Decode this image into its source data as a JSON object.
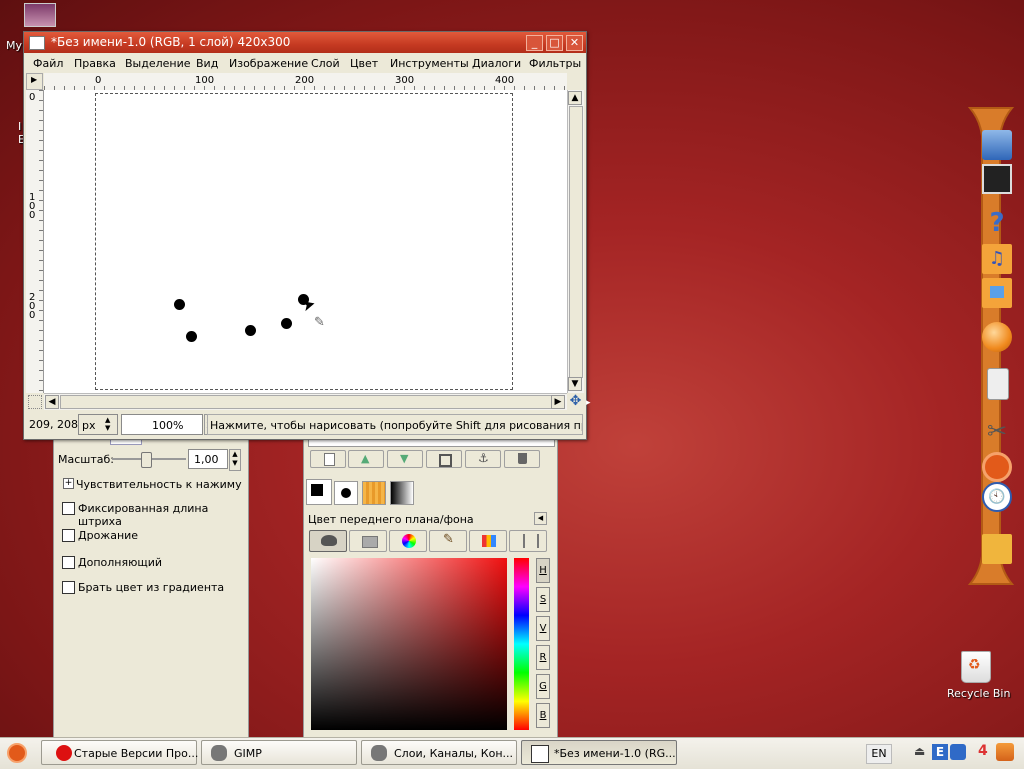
{
  "desktop": {
    "left_label_1": "My",
    "left_label_2": "I",
    "left_label_3": "E",
    "recycle_bin": "Recycle Bin"
  },
  "image_window": {
    "title": "*Без имени-1.0 (RGB, 1 слой) 420x300",
    "menu": [
      "Файл",
      "Правка",
      "Выделение",
      "Вид",
      "Изображение",
      "Слой",
      "Цвет",
      "Инструменты",
      "Диалоги",
      "Фильтры"
    ],
    "ruler_h_labels": [
      "0",
      "100",
      "200",
      "300",
      "400"
    ],
    "ruler_v_labels": [
      "0",
      "1\n0\n0",
      "2\n0\n0"
    ],
    "status": {
      "coords": "209, 208",
      "unit": "px",
      "zoom": "100%",
      "message": "Нажмите, чтобы нарисовать (попробуйте Shift для рисования прямой л..."
    }
  },
  "tool_options": {
    "scale_label": "Масштаб:",
    "scale_value": "1,00",
    "scale_fraction": 0.45,
    "pressure": "Чувствительность к нажиму",
    "fixed_length": "Фиксированная длина штриха",
    "jitter": "Дрожание",
    "incremental": "Дополняющий",
    "gradient_color": "Брать цвет из градиента"
  },
  "color_dock": {
    "tab_title": "Цвет переднего плана/фона",
    "channel_buttons": [
      "H",
      "S",
      "V",
      "R",
      "G",
      "B"
    ],
    "active_channel": "H"
  },
  "taskbar": {
    "tasks": [
      "Старые Версии Про...",
      "GIMP",
      "Слои, Каналы, Кон...",
      "*Без имени-1.0 (RG..."
    ],
    "language": "EN"
  },
  "colors": {
    "title_bar": "#c53a22",
    "desktop": "#a42424",
    "dock_bar": "#d97c2a"
  }
}
